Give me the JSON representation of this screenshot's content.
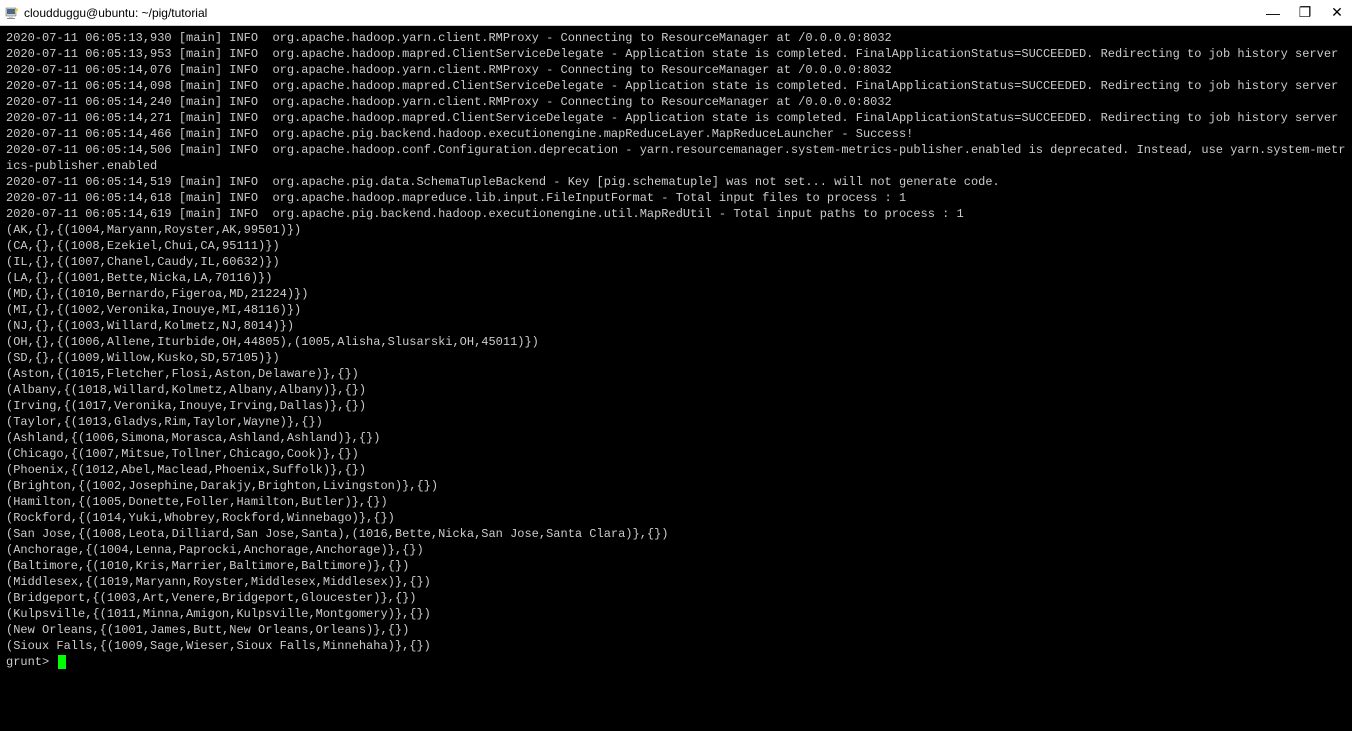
{
  "window": {
    "title": "cloudduggu@ubuntu: ~/pig/tutorial",
    "icons": {
      "putty": "putty-icon"
    },
    "controls": {
      "minimize": "—",
      "maximize": "❐",
      "close": "✕"
    }
  },
  "terminal": {
    "lines": [
      "2020-07-11 06:05:13,930 [main] INFO  org.apache.hadoop.yarn.client.RMProxy - Connecting to ResourceManager at /0.0.0.0:8032",
      "2020-07-11 06:05:13,953 [main] INFO  org.apache.hadoop.mapred.ClientServiceDelegate - Application state is completed. FinalApplicationStatus=SUCCEEDED. Redirecting to job history server",
      "2020-07-11 06:05:14,076 [main] INFO  org.apache.hadoop.yarn.client.RMProxy - Connecting to ResourceManager at /0.0.0.0:8032",
      "2020-07-11 06:05:14,098 [main] INFO  org.apache.hadoop.mapred.ClientServiceDelegate - Application state is completed. FinalApplicationStatus=SUCCEEDED. Redirecting to job history server",
      "2020-07-11 06:05:14,240 [main] INFO  org.apache.hadoop.yarn.client.RMProxy - Connecting to ResourceManager at /0.0.0.0:8032",
      "2020-07-11 06:05:14,271 [main] INFO  org.apache.hadoop.mapred.ClientServiceDelegate - Application state is completed. FinalApplicationStatus=SUCCEEDED. Redirecting to job history server",
      "2020-07-11 06:05:14,466 [main] INFO  org.apache.pig.backend.hadoop.executionengine.mapReduceLayer.MapReduceLauncher - Success!",
      "2020-07-11 06:05:14,506 [main] INFO  org.apache.hadoop.conf.Configuration.deprecation - yarn.resourcemanager.system-metrics-publisher.enabled is deprecated. Instead, use yarn.system-metrics-publisher.enabled",
      "2020-07-11 06:05:14,519 [main] INFO  org.apache.pig.data.SchemaTupleBackend - Key [pig.schematuple] was not set... will not generate code.",
      "2020-07-11 06:05:14,618 [main] INFO  org.apache.hadoop.mapreduce.lib.input.FileInputFormat - Total input files to process : 1",
      "2020-07-11 06:05:14,619 [main] INFO  org.apache.pig.backend.hadoop.executionengine.util.MapRedUtil - Total input paths to process : 1",
      "(AK,{},{(1004,Maryann,Royster,AK,99501)})",
      "(CA,{},{(1008,Ezekiel,Chui,CA,95111)})",
      "(IL,{},{(1007,Chanel,Caudy,IL,60632)})",
      "(LA,{},{(1001,Bette,Nicka,LA,70116)})",
      "(MD,{},{(1010,Bernardo,Figeroa,MD,21224)})",
      "(MI,{},{(1002,Veronika,Inouye,MI,48116)})",
      "(NJ,{},{(1003,Willard,Kolmetz,NJ,8014)})",
      "(OH,{},{(1006,Allene,Iturbide,OH,44805),(1005,Alisha,Slusarski,OH,45011)})",
      "(SD,{},{(1009,Willow,Kusko,SD,57105)})",
      "(Aston,{(1015,Fletcher,Flosi,Aston,Delaware)},{})",
      "(Albany,{(1018,Willard,Kolmetz,Albany,Albany)},{})",
      "(Irving,{(1017,Veronika,Inouye,Irving,Dallas)},{})",
      "(Taylor,{(1013,Gladys,Rim,Taylor,Wayne)},{})",
      "(Ashland,{(1006,Simona,Morasca,Ashland,Ashland)},{})",
      "(Chicago,{(1007,Mitsue,Tollner,Chicago,Cook)},{})",
      "(Phoenix,{(1012,Abel,Maclead,Phoenix,Suffolk)},{})",
      "(Brighton,{(1002,Josephine,Darakjy,Brighton,Livingston)},{})",
      "(Hamilton,{(1005,Donette,Foller,Hamilton,Butler)},{})",
      "(Rockford,{(1014,Yuki,Whobrey,Rockford,Winnebago)},{})",
      "(San Jose,{(1008,Leota,Dilliard,San Jose,Santa),(1016,Bette,Nicka,San Jose,Santa Clara)},{})",
      "(Anchorage,{(1004,Lenna,Paprocki,Anchorage,Anchorage)},{})",
      "(Baltimore,{(1010,Kris,Marrier,Baltimore,Baltimore)},{})",
      "(Middlesex,{(1019,Maryann,Royster,Middlesex,Middlesex)},{})",
      "(Bridgeport,{(1003,Art,Venere,Bridgeport,Gloucester)},{})",
      "(Kulpsville,{(1011,Minna,Amigon,Kulpsville,Montgomery)},{})",
      "(New Orleans,{(1001,James,Butt,New Orleans,Orleans)},{})",
      "(Sioux Falls,{(1009,Sage,Wieser,Sioux Falls,Minnehaha)},{})"
    ],
    "prompt": "grunt> "
  }
}
